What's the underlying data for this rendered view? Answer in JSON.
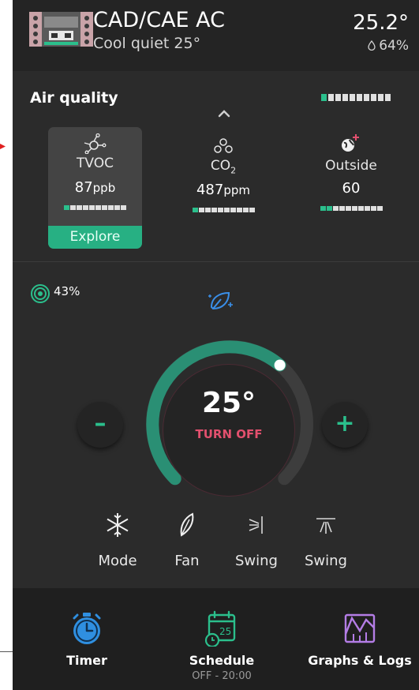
{
  "header": {
    "title": "CAD/CAE AC",
    "subtitle": "Cool quiet 25°",
    "temperature": "25.2°",
    "humidity": "64%"
  },
  "air_quality": {
    "title": "Air quality",
    "overall_level_segments": 10,
    "overall_level_filled": 1,
    "sensors": [
      {
        "label": "TVOC",
        "value": "87",
        "unit": "ppb",
        "level_filled": 1,
        "action": "Explore"
      },
      {
        "label": "CO",
        "label_sub": "2",
        "value": "487",
        "unit": "ppm",
        "level_filled": 1
      },
      {
        "label": "Outside",
        "value": "60",
        "unit": "",
        "level_filled": 2
      }
    ]
  },
  "climate": {
    "fan_percent": "43%",
    "setpoint": "25°",
    "setpoint_level": 0.65,
    "power_action": "TURN OFF",
    "decrease_label": "–",
    "increase_label": "+"
  },
  "controls": [
    {
      "label": "Mode",
      "icon": "snowflake-icon"
    },
    {
      "label": "Fan",
      "icon": "feather-icon"
    },
    {
      "label": "Swing",
      "icon": "swing-horizontal-icon"
    },
    {
      "label": "Swing",
      "icon": "swing-vertical-icon"
    }
  ],
  "footer": {
    "timer_label": "Timer",
    "schedule_label": "Schedule",
    "schedule_status": "OFF - 20:00",
    "schedule_day": "25",
    "graphs_label": "Graphs & Logs"
  },
  "colors": {
    "accent": "#2bbf8c",
    "off": "#e2506e",
    "timer_blue": "#2f8fe0",
    "graphs_purple": "#b47de6"
  }
}
